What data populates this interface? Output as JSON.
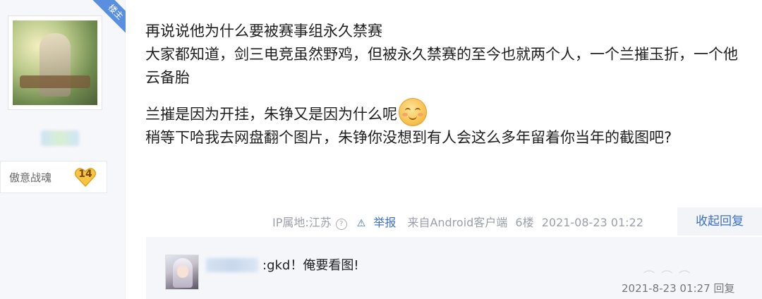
{
  "author": {
    "owner_badge": "楼主",
    "level_title": "傲意战魂",
    "level_number": "14"
  },
  "post": {
    "lines": [
      "再说说他为什么要被赛事组永久禁赛",
      "大家都知道，剑三电竞虽然野鸡，但被永久禁赛的至今也就两个人，一个兰摧玉折，一个他",
      "云备胎",
      "兰摧是因为开挂，朱铮又是因为什么呢",
      "稍等下哈我去网盘翻个图片，朱铮你没想到有人会这么多年留着你当年的截图吧?"
    ],
    "emoji_icon": "smiling-face-emoji"
  },
  "meta": {
    "ip_location": "IP属地:江苏",
    "report_label": "举报",
    "source": "来自Android客户端",
    "floor": "6楼",
    "timestamp": "2021-08-23 01:22",
    "collapse_label": "收起回复"
  },
  "reply": {
    "text": ":gkd！俺要看图!",
    "timestamp": "2021-8-23 01:27",
    "reply_label": "回复"
  },
  "colors": {
    "link": "#3a6fc4",
    "ribbon": "#5a8fe0",
    "sidebar_bg": "#f6f7fb",
    "reply_bg": "#f5f6fa"
  }
}
